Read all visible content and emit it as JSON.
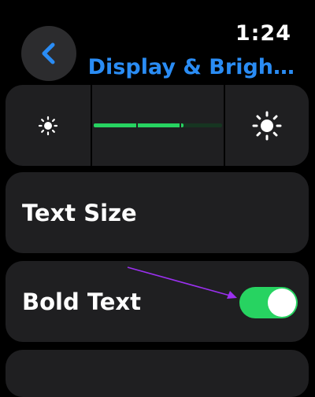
{
  "status": {
    "time": "1:24"
  },
  "header": {
    "title": "Display & Brigh…",
    "back_icon": "chevron-left-icon"
  },
  "brightness": {
    "low_icon": "sun-small-icon",
    "high_icon": "sun-large-icon",
    "level": 0.7
  },
  "rows": [
    {
      "label": "Text Size"
    },
    {
      "label": "Bold Text",
      "toggle_on": true
    }
  ],
  "colors": {
    "accent": "#2a8cf4",
    "toggle_on": "#27d361",
    "annotation_arrow": "#9b30f0"
  }
}
